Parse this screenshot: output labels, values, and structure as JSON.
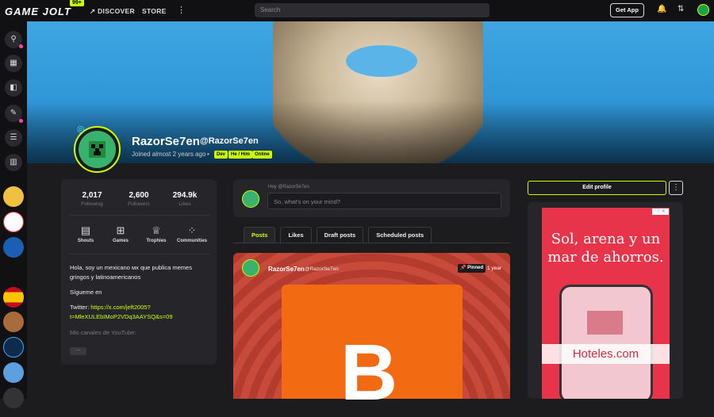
{
  "topbar": {
    "logo": "GAME JOLT",
    "badge": "99+",
    "discover": "DISCOVER",
    "store": "STORE",
    "more": "⋮",
    "search_placeholder": "Search",
    "get_app": "Get App"
  },
  "profile": {
    "display_name": "RazorSe7en",
    "username": "@RazorSe7en",
    "joined": "Joined almost 2 years ago",
    "tags": [
      "Dev",
      "He / Him",
      "Online"
    ]
  },
  "stats": [
    {
      "value": "2,017",
      "label": "Following"
    },
    {
      "value": "2,600",
      "label": "Followers"
    },
    {
      "value": "294.9k",
      "label": "Likes"
    }
  ],
  "actions": [
    {
      "label": "Shouts",
      "icon": "chat-bubble-icon"
    },
    {
      "label": "Games",
      "icon": "gamepad-icon"
    },
    {
      "label": "Trophies",
      "icon": "trophy-icon"
    },
    {
      "label": "Communities",
      "icon": "communities-icon"
    }
  ],
  "bio": {
    "line1": "Hola, soy un mexicano ᴍx que publica memes",
    "line2": "gringos y latinoamericanos",
    "follow": "Sígueme en",
    "twitter_label": "Twitter: ",
    "twitter_link1": "https://x.com/jeft2005?",
    "twitter_link2": "t=MleXULEbIMoP2VDq3AAYSQ&s=09",
    "youtube": "Mis canales de YouTube:",
    "more": "···"
  },
  "shout": {
    "hey": "Hey @RazorSe7en",
    "placeholder": "So, what's on your mind?"
  },
  "tabs": [
    "Posts",
    "Likes",
    "Draft posts",
    "Scheduled posts"
  ],
  "post": {
    "name": "RazorSe7en",
    "user": "@RazorSe7en",
    "pinned": "Pinned",
    "time": "1 year",
    "image_letter": "B"
  },
  "side": {
    "edit_profile": "Edit profile",
    "kebab": "⋮"
  },
  "ad": {
    "headline": "Sol, arena y un mar de ahorros.",
    "brand": "Hoteles.com",
    "tag": "ⓘ ✕"
  },
  "colors": {
    "accent": "#ccff00",
    "notification": "#ff3fac",
    "background": "#1c1c1f"
  }
}
